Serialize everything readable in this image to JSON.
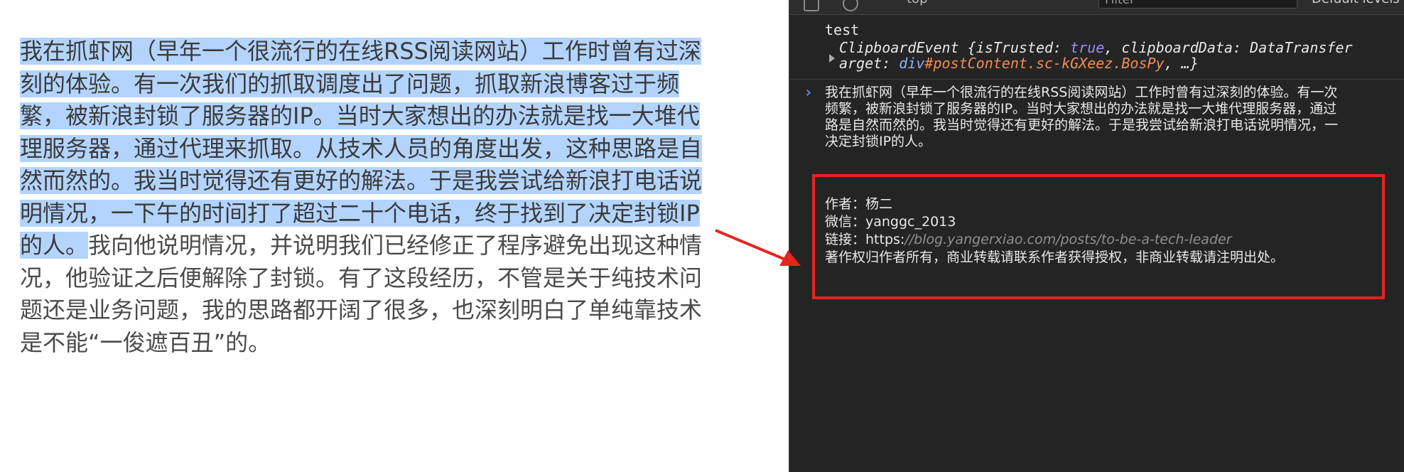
{
  "article": {
    "highlighted": "我在抓虾网（早年一个很流行的在线RSS阅读网站）工作时曾有过深刻的体验。有一次我们的抓取调度出了问题，抓取新浪博客过于频繁，被新浪封锁了服务器的IP。当时大家想出的办法就是找一大堆代理服务器，通过代理来抓取。从技术人员的角度出发，这种思路是自然而然的。我当时觉得还有更好的解法。于是我尝试给新浪打电话说明情况，一下午的时间打了超过二十个电话，终于找到了决定封锁IP的人。",
    "rest": "我向他说明情况，并说明我们已经修正了程序避免出现这种情况，他验证之后便解除了封锁。有了这段经历，不管是关于纯技术问题还是业务问题，我的思路都开阔了很多，也深刻明白了单纯靠技术是不能“一俊遮百丑”的。"
  },
  "devtools": {
    "toolbar": {
      "context": "top",
      "filter_placeholder": "Filter",
      "levels": "Default levels"
    },
    "log_test": "test",
    "event": {
      "class_name": "ClipboardEvent",
      "open": " {",
      "k1": "isTrusted",
      "v1": "true",
      "k2": "clipboardData",
      "v2": "DataTransfer",
      "line2_prefix": "arget: ",
      "v3a": "div",
      "v3b": "#postContent.sc-kGXeez.BosPy",
      "close": ", …}"
    },
    "output": {
      "line1": "我在抓虾网（早年一个很流行的在线RSS阅读网站）工作时曾有过深刻的体验。有一次",
      "line2": "频繁，被新浪封锁了服务器的IP。当时大家想出的办法就是找一大堆代理服务器，通过",
      "line3": "路是自然而然的。我当时觉得还有更好的解法。于是我尝试给新浪打电话说明情况，一",
      "line4": "决定封锁IP的人。",
      "author": "作者：杨二",
      "wechat": "微信：yanggc_2013",
      "link_label": "链接：https:",
      "link_rest": "//blog.yangerxiao.com/posts/to-be-a-tech-leader",
      "copyright": "著作权归作者所有，商业转载请联系作者获得授权，非商业转载请注明出处。"
    }
  },
  "colors": {
    "selection": "#b3d4fe",
    "highlight_border": "#e3261f",
    "devtools_bg": "#242424"
  }
}
